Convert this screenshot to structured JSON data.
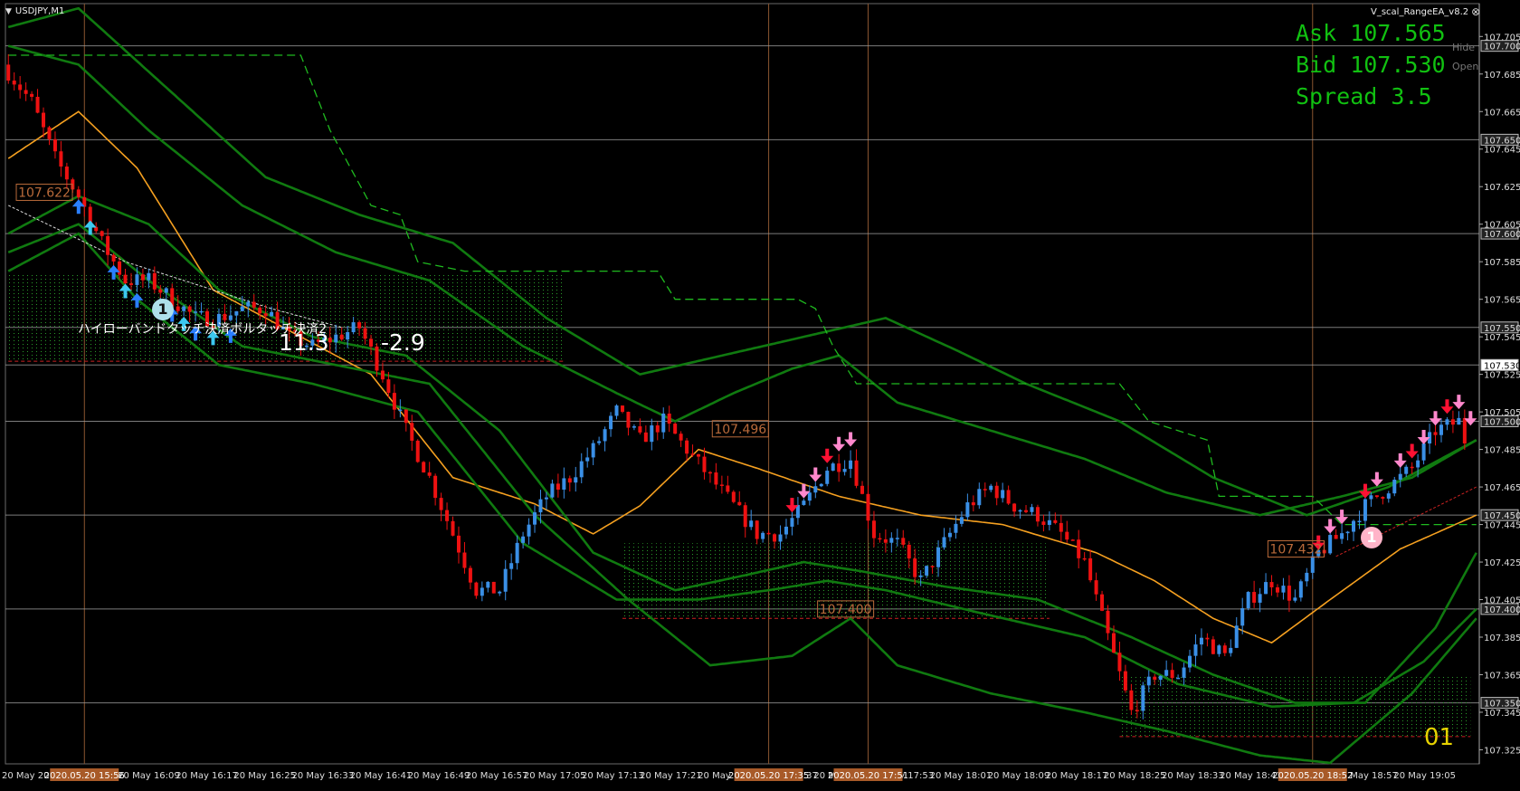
{
  "window": {
    "symbol_title": "USDJPY,M1",
    "ea_label": "V_scal_RangeEA_v8.2",
    "close_glyph": "⊗",
    "dropdown_glyph": "▼"
  },
  "hud": {
    "ask": "Ask 107.565",
    "bid": "Bid 107.530",
    "spread": "Spread 3.5",
    "hide": "Hide",
    "open": "Open",
    "counter": "01"
  },
  "annotations": {
    "japanese_note": "ハイローバンドタッチ決済ボルタッチ決済2",
    "pl_values": [
      "11.3",
      "-2.9"
    ],
    "badge_number": "1",
    "level_labels": [
      {
        "text": "107.622",
        "price": 107.622
      },
      {
        "text": "107.496",
        "price": 107.496
      },
      {
        "text": "107.400",
        "price": 107.4
      },
      {
        "text": "107.432",
        "price": 107.432
      }
    ]
  },
  "price_axis": {
    "ticks": [
      "107.705",
      "107.685",
      "107.665",
      "107.645",
      "107.625",
      "107.605",
      "107.585",
      "107.565",
      "107.545",
      "107.525",
      "107.505",
      "107.485",
      "107.465",
      "107.445",
      "107.425",
      "107.405",
      "107.385",
      "107.365",
      "107.345",
      "107.325"
    ],
    "tick_values": [
      107.705,
      107.685,
      107.665,
      107.645,
      107.625,
      107.605,
      107.585,
      107.565,
      107.545,
      107.525,
      107.505,
      107.485,
      107.465,
      107.445,
      107.425,
      107.405,
      107.385,
      107.365,
      107.345,
      107.325
    ],
    "level_tags": [
      "107.700",
      "107.650",
      "107.600",
      "107.550",
      "107.530",
      "107.500",
      "107.450",
      "107.400",
      "107.350"
    ],
    "level_values": [
      107.7,
      107.65,
      107.6,
      107.55,
      107.53,
      107.5,
      107.45,
      107.4,
      107.35
    ],
    "range": [
      107.3175,
      107.7225
    ]
  },
  "time_axis": {
    "labels": [
      "20 May 202",
      "20 May 16:01",
      "20 May 16:09",
      "20 May 16:17",
      "20 May 16:25",
      "20 May 16:33",
      "20 May 16:41",
      "20 May 16:49",
      "20 May 16:57",
      "20 May 17:05",
      "20 May 17:13",
      "20 May 17:21",
      "20 May 17:29",
      "20 May 17:37",
      "20 May 17:45",
      "20 May 17:53",
      "20 May 18:01",
      "20 May 18:09",
      "20 May 18:17",
      "20 May 18:25",
      "20 May 18:33",
      "20 May 18:41",
      "20 May 18:49",
      "20 May 18:57",
      "20 May 19:05"
    ],
    "highlights": [
      "2020.05.20 15:56",
      "2020.05.20 17:35",
      "2020.05.20 17:51",
      "2020.05.20 18:52"
    ]
  },
  "colors": {
    "bull": "#3a8fe6",
    "bear": "#ee1111",
    "band": "#107a10",
    "ma": "#f5a020",
    "step": "#1fba1f",
    "hline": "#9a9a9a",
    "vline": "#8a5530",
    "buy_arrow": "#2a7fff",
    "buy_arrow_light": "#3cc8f0",
    "sell_arrow": "#ff1133",
    "sell_arrow_pink": "#ff88cc",
    "hud_text": "#11c011",
    "level_label": "#b96a3a",
    "highlight_box": "#a85a28"
  },
  "chart_data": {
    "type": "candlestick",
    "symbol": "USDJPY",
    "timeframe": "M1",
    "close_path": [
      [
        0,
        107.69
      ],
      [
        5,
        107.67
      ],
      [
        9,
        107.64
      ],
      [
        13,
        107.62
      ],
      [
        17,
        107.595
      ],
      [
        21,
        107.575
      ],
      [
        25,
        107.575
      ],
      [
        29,
        107.565
      ],
      [
        33,
        107.555
      ],
      [
        37,
        107.555
      ],
      [
        41,
        107.56
      ],
      [
        45,
        107.56
      ],
      [
        49,
        107.545
      ],
      [
        53,
        107.54
      ],
      [
        57,
        107.545
      ],
      [
        61,
        107.55
      ],
      [
        65,
        107.525
      ],
      [
        69,
        107.495
      ],
      [
        73,
        107.47
      ],
      [
        77,
        107.44
      ],
      [
        81,
        107.41
      ],
      [
        85,
        107.41
      ],
      [
        89,
        107.44
      ],
      [
        93,
        107.46
      ],
      [
        97,
        107.47
      ],
      [
        101,
        107.485
      ],
      [
        105,
        107.505
      ],
      [
        109,
        107.49
      ],
      [
        113,
        107.5
      ],
      [
        117,
        107.485
      ],
      [
        121,
        107.47
      ],
      [
        125,
        107.455
      ],
      [
        129,
        107.44
      ],
      [
        133,
        107.44
      ],
      [
        137,
        107.455
      ],
      [
        141,
        107.475
      ],
      [
        145,
        107.48
      ],
      [
        149,
        107.44
      ],
      [
        153,
        107.435
      ],
      [
        157,
        107.415
      ],
      [
        161,
        107.435
      ],
      [
        165,
        107.455
      ],
      [
        169,
        107.465
      ],
      [
        173,
        107.455
      ],
      [
        177,
        107.45
      ],
      [
        181,
        107.44
      ],
      [
        185,
        107.425
      ],
      [
        189,
        107.385
      ],
      [
        193,
        107.345
      ],
      [
        197,
        107.365
      ],
      [
        201,
        107.365
      ],
      [
        205,
        107.385
      ],
      [
        209,
        107.375
      ],
      [
        213,
        107.405
      ],
      [
        217,
        107.415
      ],
      [
        221,
        107.405
      ],
      [
        225,
        107.43
      ],
      [
        229,
        107.44
      ],
      [
        233,
        107.455
      ],
      [
        237,
        107.465
      ],
      [
        241,
        107.475
      ],
      [
        245,
        107.495
      ],
      [
        249,
        107.5
      ],
      [
        251,
        107.48
      ]
    ],
    "series": [
      {
        "name": "MA",
        "values": [
          [
            0,
            107.64
          ],
          [
            12,
            107.665
          ],
          [
            22,
            107.635
          ],
          [
            35,
            107.57
          ],
          [
            50,
            107.545
          ],
          [
            62,
            107.525
          ],
          [
            76,
            107.47
          ],
          [
            90,
            107.456
          ],
          [
            100,
            107.44
          ],
          [
            108,
            107.455
          ],
          [
            118,
            107.485
          ],
          [
            128,
            107.475
          ],
          [
            142,
            107.46
          ],
          [
            156,
            107.45
          ],
          [
            170,
            107.445
          ],
          [
            186,
            107.43
          ],
          [
            196,
            107.415
          ],
          [
            206,
            107.395
          ],
          [
            216,
            107.382
          ],
          [
            226,
            107.405
          ],
          [
            238,
            107.432
          ],
          [
            251,
            107.45
          ]
        ]
      },
      {
        "name": "Band1",
        "values": [
          [
            0,
            107.7
          ],
          [
            12,
            107.69
          ],
          [
            24,
            107.655
          ],
          [
            40,
            107.615
          ],
          [
            56,
            107.59
          ],
          [
            72,
            107.575
          ],
          [
            88,
            107.54
          ],
          [
            104,
            107.515
          ],
          [
            114,
            107.5
          ],
          [
            124,
            107.515
          ],
          [
            134,
            107.528
          ],
          [
            142,
            107.535
          ],
          [
            152,
            107.51
          ],
          [
            168,
            107.495
          ],
          [
            184,
            107.48
          ],
          [
            198,
            107.462
          ],
          [
            214,
            107.45
          ],
          [
            228,
            107.46
          ],
          [
            240,
            107.47
          ],
          [
            251,
            107.49
          ]
        ]
      },
      {
        "name": "Band2",
        "values": [
          [
            0,
            107.71
          ],
          [
            12,
            107.72
          ],
          [
            28,
            107.675
          ],
          [
            44,
            107.63
          ],
          [
            60,
            107.61
          ],
          [
            76,
            107.595
          ],
          [
            92,
            107.555
          ],
          [
            108,
            107.525
          ],
          [
            122,
            107.535
          ],
          [
            136,
            107.545
          ],
          [
            150,
            107.555
          ],
          [
            162,
            107.538
          ],
          [
            174,
            107.52
          ],
          [
            190,
            107.5
          ],
          [
            206,
            107.47
          ],
          [
            222,
            107.45
          ],
          [
            236,
            107.465
          ],
          [
            251,
            107.49
          ]
        ]
      },
      {
        "name": "Band3",
        "values": [
          [
            0,
            107.6
          ],
          [
            12,
            107.62
          ],
          [
            24,
            107.605
          ],
          [
            36,
            107.57
          ],
          [
            52,
            107.545
          ],
          [
            68,
            107.535
          ],
          [
            84,
            107.495
          ],
          [
            100,
            107.43
          ],
          [
            114,
            107.41
          ],
          [
            126,
            107.418
          ],
          [
            136,
            107.425
          ],
          [
            146,
            107.42
          ],
          [
            160,
            107.412
          ],
          [
            176,
            107.405
          ],
          [
            192,
            107.385
          ],
          [
            206,
            107.365
          ],
          [
            220,
            107.35
          ],
          [
            232,
            107.35
          ],
          [
            244,
            107.39
          ],
          [
            251,
            107.43
          ]
        ]
      },
      {
        "name": "Band4",
        "values": [
          [
            0,
            107.59
          ],
          [
            12,
            107.605
          ],
          [
            24,
            107.575
          ],
          [
            40,
            107.54
          ],
          [
            56,
            107.53
          ],
          [
            72,
            107.52
          ],
          [
            90,
            107.45
          ],
          [
            106,
            107.405
          ],
          [
            120,
            107.37
          ],
          [
            134,
            107.375
          ],
          [
            144,
            107.395
          ],
          [
            152,
            107.37
          ],
          [
            168,
            107.355
          ],
          [
            184,
            107.345
          ],
          [
            198,
            107.335
          ],
          [
            214,
            107.322
          ],
          [
            226,
            107.318
          ],
          [
            240,
            107.355
          ],
          [
            251,
            107.395
          ]
        ]
      },
      {
        "name": "Band5",
        "values": [
          [
            0,
            107.58
          ],
          [
            12,
            107.6
          ],
          [
            22,
            107.565
          ],
          [
            36,
            107.53
          ],
          [
            52,
            107.52
          ],
          [
            70,
            107.505
          ],
          [
            88,
            107.435
          ],
          [
            104,
            107.405
          ],
          [
            118,
            107.405
          ],
          [
            130,
            107.41
          ],
          [
            140,
            107.415
          ],
          [
            150,
            107.41
          ],
          [
            166,
            107.398
          ],
          [
            184,
            107.385
          ],
          [
            200,
            107.36
          ],
          [
            216,
            107.348
          ],
          [
            230,
            107.35
          ],
          [
            242,
            107.372
          ],
          [
            251,
            107.4
          ]
        ]
      }
    ],
    "step_line": [
      [
        0,
        107.695
      ],
      [
        50,
        107.695
      ],
      [
        55,
        107.655
      ],
      [
        62,
        107.615
      ],
      [
        67,
        107.61
      ],
      [
        70,
        107.585
      ],
      [
        78,
        107.58
      ],
      [
        111,
        107.58
      ],
      [
        114,
        107.565
      ],
      [
        135,
        107.565
      ],
      [
        138,
        107.56
      ],
      [
        141,
        107.54
      ],
      [
        145,
        107.52
      ],
      [
        190,
        107.52
      ],
      [
        195,
        107.5
      ],
      [
        205,
        107.49
      ],
      [
        207,
        107.46
      ],
      [
        223,
        107.46
      ],
      [
        228,
        107.445
      ],
      [
        251,
        107.445
      ]
    ],
    "buy_signals_x": [
      12,
      14,
      18,
      20,
      22,
      26,
      28,
      30,
      32,
      35,
      38
    ],
    "sell_signals_x": [
      134,
      136,
      138,
      140,
      142,
      144,
      224,
      226,
      228,
      232,
      234,
      238,
      240,
      242,
      244,
      246,
      248,
      250
    ],
    "ylim": [
      107.3175,
      107.7225
    ]
  }
}
